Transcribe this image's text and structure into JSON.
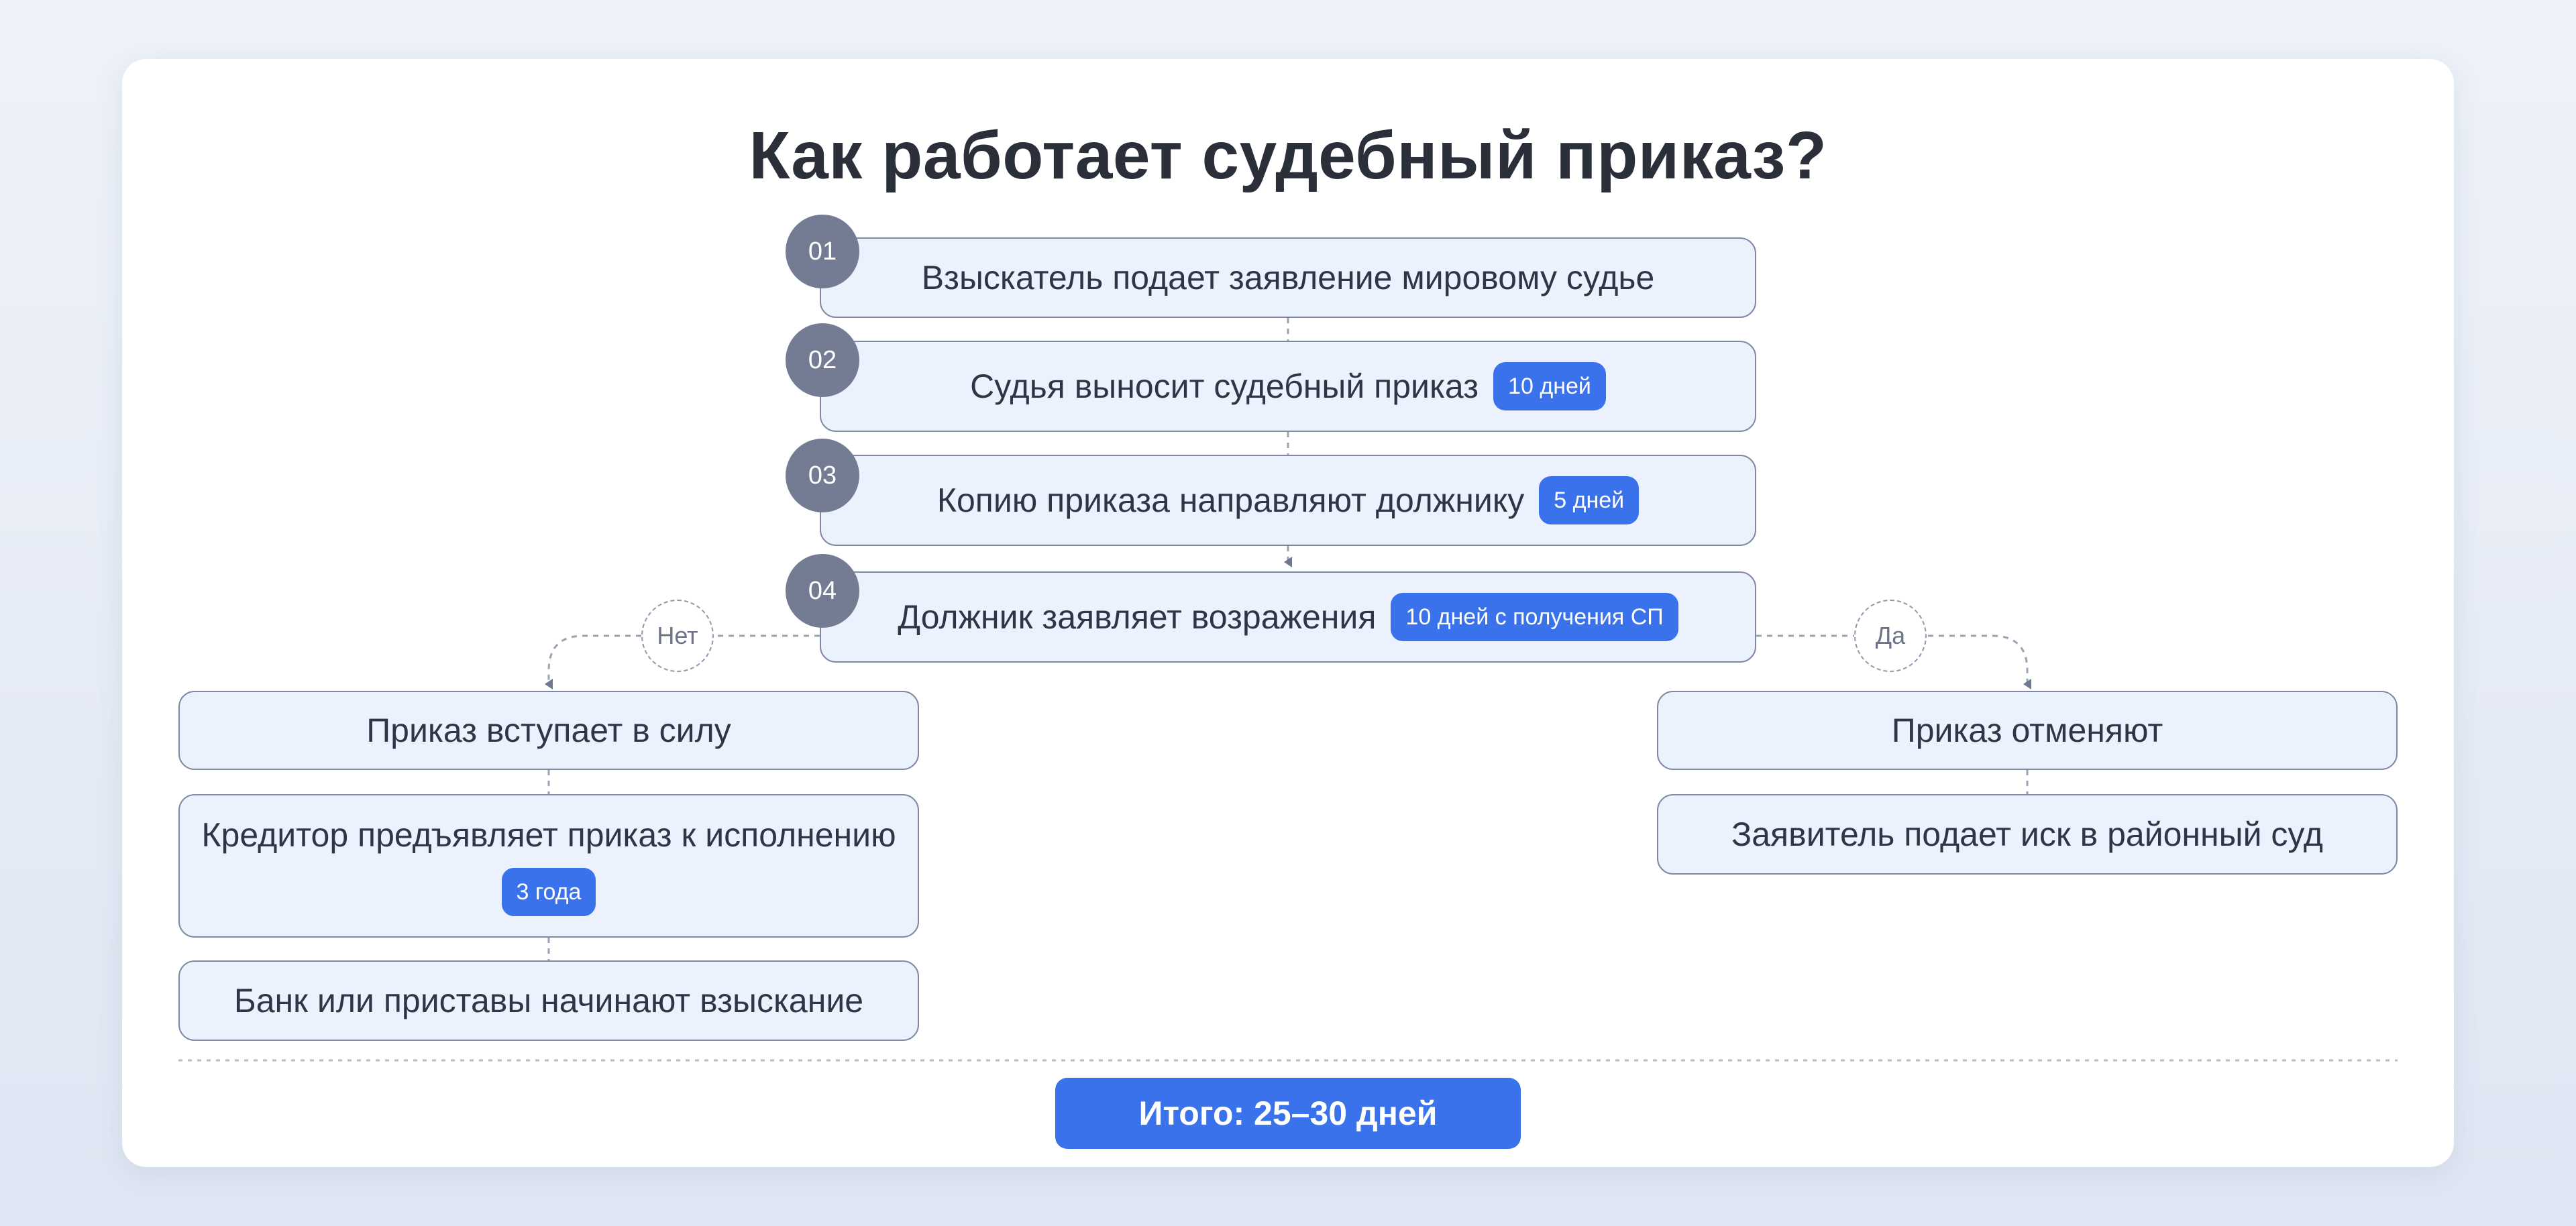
{
  "title": "Как работает судебный приказ?",
  "steps": [
    {
      "num": "01",
      "text": "Взыскатель подает заявление мировому судье",
      "badge": ""
    },
    {
      "num": "02",
      "text": "Судья выносит судебный приказ",
      "badge": "10 дней"
    },
    {
      "num": "03",
      "text": "Копию приказа направляют должнику",
      "badge": "5 дней"
    },
    {
      "num": "04",
      "text": "Должник заявляет возражения",
      "badge": "10 дней с получения СП"
    }
  ],
  "branch_no": {
    "label": "Нет",
    "items": [
      {
        "text": "Приказ вступает в силу",
        "badge": ""
      },
      {
        "text": "Кредитор предъявляет приказ к исполнению",
        "badge": "3 года"
      },
      {
        "text": "Банк или приставы начинают взыскание",
        "badge": ""
      }
    ]
  },
  "branch_yes": {
    "label": "Да",
    "items": [
      {
        "text": "Приказ отменяют",
        "badge": ""
      },
      {
        "text": "Заявитель подает иск в районный суд",
        "badge": ""
      }
    ]
  },
  "total": "Итого: 25–30 дней",
  "colors": {
    "accent": "#3a72eb",
    "box_fill": "#ecf2fd",
    "box_border": "#7f8aa3",
    "step_circle": "#737c93"
  }
}
